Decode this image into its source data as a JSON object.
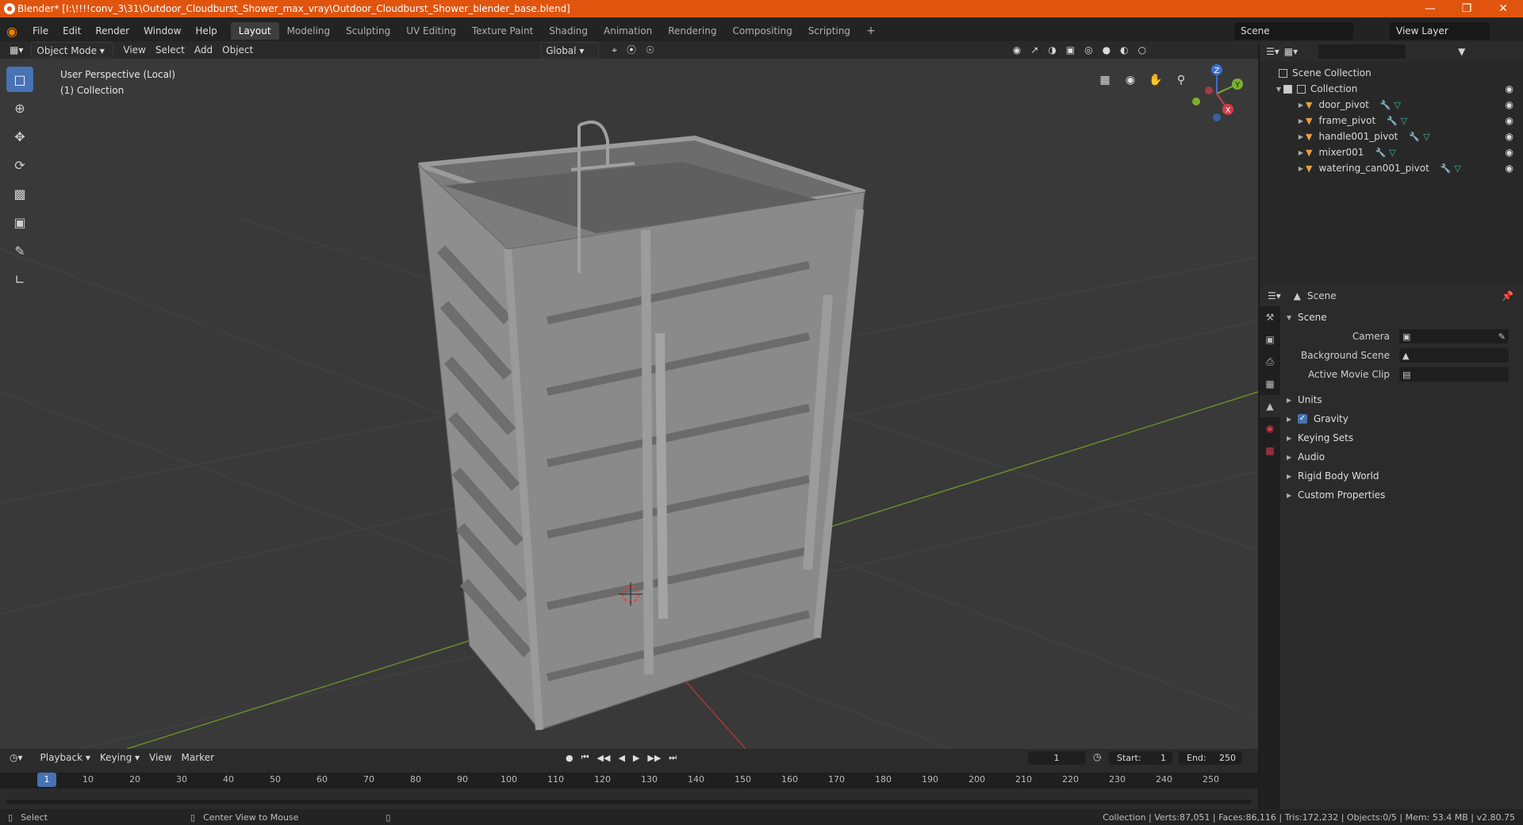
{
  "window": {
    "title": "Blender* [I:\\!!!!conv_3\\31\\Outdoor_Cloudburst_Shower_max_vray\\Outdoor_Cloudburst_Shower_blender_base.blend]"
  },
  "menu": [
    "File",
    "Edit",
    "Render",
    "Window",
    "Help"
  ],
  "workspaces": [
    "Layout",
    "Modeling",
    "Sculpting",
    "UV Editing",
    "Texture Paint",
    "Shading",
    "Animation",
    "Rendering",
    "Compositing",
    "Scripting",
    "+"
  ],
  "scene_name": "Scene",
  "view_layer": "View Layer",
  "viewport_header": {
    "mode": "Object Mode",
    "view": "View",
    "select": "Select",
    "add": "Add",
    "object": "Object",
    "orientation": "Global"
  },
  "viewport_info": {
    "line1": "User Perspective (Local)",
    "line2": "(1) Collection"
  },
  "gizmo": {
    "z": "Z",
    "y": "Y",
    "x": "X"
  },
  "outliner": {
    "root": "Scene Collection",
    "collection": "Collection",
    "items": [
      "door_pivot",
      "frame_pivot",
      "handle001_pivot",
      "mixer001",
      "watering_can001_pivot"
    ]
  },
  "properties": {
    "header": "Scene",
    "section": "Scene",
    "camera_label": "Camera",
    "bg_scene_label": "Background Scene",
    "movie_clip_label": "Active Movie Clip",
    "panels": [
      "Units",
      "Gravity",
      "Keying Sets",
      "Audio",
      "Rigid Body World",
      "Custom Properties"
    ]
  },
  "timeline": {
    "playback": "Playback",
    "keying": "Keying",
    "view": "View",
    "marker": "Marker",
    "current_frame": "1",
    "start_label": "Start:",
    "start": "1",
    "end_label": "End:",
    "end": "250",
    "ticks": [
      "1",
      "10",
      "20",
      "30",
      "40",
      "50",
      "60",
      "70",
      "80",
      "90",
      "100",
      "110",
      "120",
      "130",
      "140",
      "150",
      "160",
      "170",
      "180",
      "190",
      "200",
      "210",
      "220",
      "230",
      "240",
      "250"
    ]
  },
  "status": {
    "select": "Select",
    "center": "Center View to Mouse",
    "stats": "Collection | Verts:87,051 | Faces:86,116 | Tris:172,232 | Objects:0/5 | Mem: 53.4 MB | v2.80.75"
  }
}
